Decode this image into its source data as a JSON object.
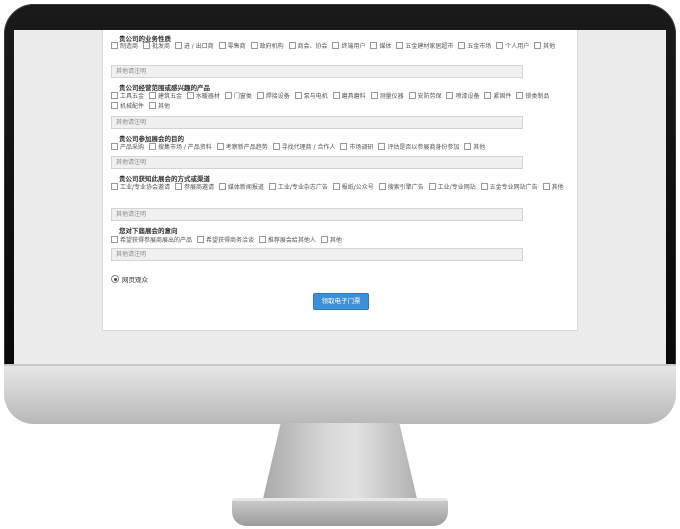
{
  "form": {
    "questions": [
      {
        "title": "贵公司的业务性质",
        "options": [
          "制造商",
          "批发商",
          "进 / 出口商",
          "零售商",
          "政府机构",
          "商会、协会",
          "终端用户",
          "媒体",
          "五金建材家居超市",
          "五金市场",
          "个人用户",
          "其他"
        ],
        "other_placeholder": "其他请注明"
      },
      {
        "title": "贵公司经营范围或感兴趣的产品",
        "options": [
          "工具五金",
          "建筑五金",
          "水暖器材",
          "门窗类",
          "焊接设备",
          "泵与电机",
          "磨具磨料",
          "测量仪器",
          "安防劳保",
          "喷漆设备",
          "紧固件",
          "锁类制品",
          "机械配件",
          "其他"
        ],
        "other_placeholder": "其他请注明"
      },
      {
        "title": "贵公司参加展会的目的",
        "options": [
          "产品采购",
          "搜集市场 / 产品资料",
          "考察新产品趋势",
          "寻找代理商 / 合作人",
          "市场调研",
          "评估是否以参展商身份参加",
          "其他"
        ],
        "other_placeholder": "其他请注明"
      },
      {
        "title": "贵公司获知此展会的方式或渠道",
        "options": [
          "工业/专业协会邀请",
          "参展商邀请",
          "媒体新闻报道",
          "工业/专业杂志广告",
          "报纸/公众号",
          "搜索引擎广告",
          "工业/专业网站",
          "五金专业网站广告",
          "其他"
        ],
        "other_placeholder": "其他请注明"
      },
      {
        "title": "您对下届展会的意向",
        "options": [
          "希望获得参展商展出的产品",
          "希望获得商务洽谈",
          "推荐展会给其他人",
          "其他"
        ],
        "other_placeholder": "其他请注明"
      }
    ],
    "radio_label": "网页观众",
    "submit_label": "领取电子门票"
  }
}
